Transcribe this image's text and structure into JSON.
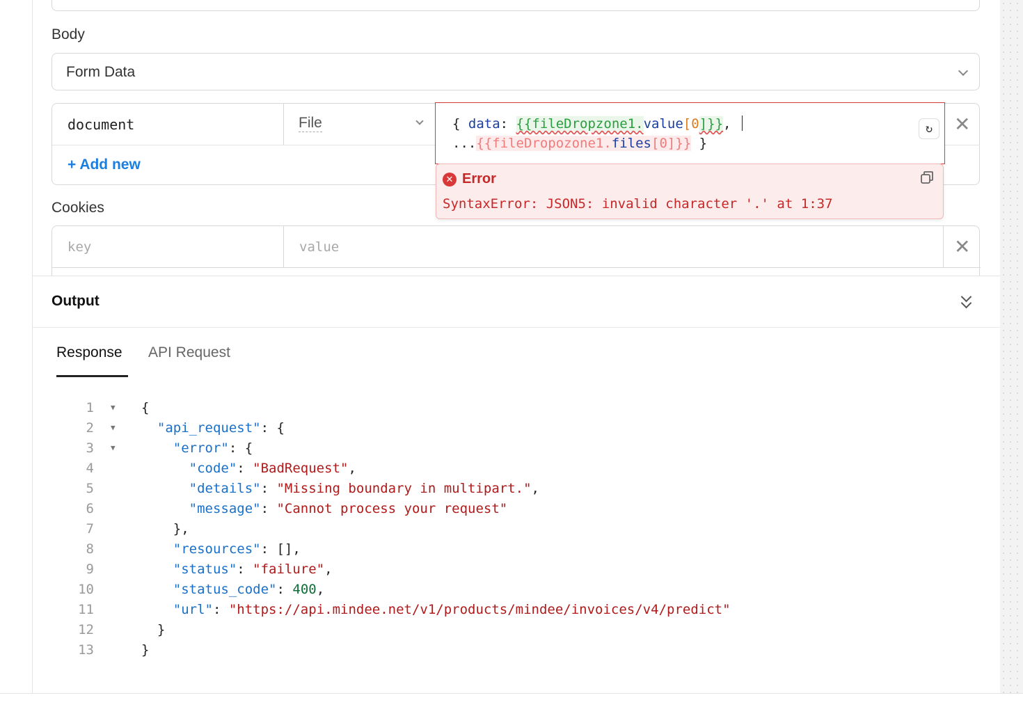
{
  "body_section": {
    "label": "Body",
    "body_type": "Form Data"
  },
  "form_row": {
    "key": "document",
    "type": "File",
    "value_line1_parts": [
      "{ ",
      "data",
      ": ",
      "{{fileDropzone1.",
      "value",
      "[",
      "0",
      "]}}",
      ","
    ],
    "value_line2_parts": [
      "...",
      "{{fileDropozone1.",
      "files",
      "[",
      "0",
      "]}}",
      " }"
    ],
    "add_new_label": "+ Add new"
  },
  "error_popup": {
    "title": "Error",
    "message": "SyntaxError: JSON5: invalid character '.' at 1:37"
  },
  "cookies_section": {
    "label": "Cookies",
    "key_placeholder": "key",
    "value_placeholder": "value"
  },
  "output": {
    "title": "Output",
    "tabs": [
      {
        "label": "Response",
        "active": true
      },
      {
        "label": "API Request",
        "active": false
      }
    ]
  },
  "response_code": {
    "line_numbers": [
      "1",
      "2",
      "3",
      "4",
      "5",
      "6",
      "7",
      "8",
      "9",
      "10",
      "11",
      "12",
      "13"
    ],
    "lines": [
      {
        "indent": "",
        "parts": [
          {
            "t": "{",
            "c": "p"
          }
        ]
      },
      {
        "indent": "  ",
        "parts": [
          {
            "t": "\"api_request\"",
            "c": "k"
          },
          {
            "t": ": {",
            "c": "p"
          }
        ]
      },
      {
        "indent": "    ",
        "parts": [
          {
            "t": "\"error\"",
            "c": "k"
          },
          {
            "t": ": {",
            "c": "p"
          }
        ]
      },
      {
        "indent": "      ",
        "parts": [
          {
            "t": "\"code\"",
            "c": "k"
          },
          {
            "t": ": ",
            "c": "p"
          },
          {
            "t": "\"BadRequest\"",
            "c": "s"
          },
          {
            "t": ",",
            "c": "p"
          }
        ]
      },
      {
        "indent": "      ",
        "parts": [
          {
            "t": "\"details\"",
            "c": "k"
          },
          {
            "t": ": ",
            "c": "p"
          },
          {
            "t": "\"Missing boundary in multipart.\"",
            "c": "s"
          },
          {
            "t": ",",
            "c": "p"
          }
        ]
      },
      {
        "indent": "      ",
        "parts": [
          {
            "t": "\"message\"",
            "c": "k"
          },
          {
            "t": ": ",
            "c": "p"
          },
          {
            "t": "\"Cannot process your request\"",
            "c": "s"
          }
        ]
      },
      {
        "indent": "    ",
        "parts": [
          {
            "t": "},",
            "c": "p"
          }
        ]
      },
      {
        "indent": "    ",
        "parts": [
          {
            "t": "\"resources\"",
            "c": "k"
          },
          {
            "t": ": [],",
            "c": "p"
          }
        ]
      },
      {
        "indent": "    ",
        "parts": [
          {
            "t": "\"status\"",
            "c": "k"
          },
          {
            "t": ": ",
            "c": "p"
          },
          {
            "t": "\"failure\"",
            "c": "s"
          },
          {
            "t": ",",
            "c": "p"
          }
        ]
      },
      {
        "indent": "    ",
        "parts": [
          {
            "t": "\"status_code\"",
            "c": "k"
          },
          {
            "t": ": ",
            "c": "p"
          },
          {
            "t": "400",
            "c": "n"
          },
          {
            "t": ",",
            "c": "p"
          }
        ]
      },
      {
        "indent": "    ",
        "parts": [
          {
            "t": "\"url\"",
            "c": "k"
          },
          {
            "t": ": ",
            "c": "p"
          },
          {
            "t": "\"https://api.mindee.net/v1/products/mindee/invoices/v4/predict\"",
            "c": "s"
          }
        ]
      },
      {
        "indent": "  ",
        "parts": [
          {
            "t": "}",
            "c": "p"
          }
        ]
      },
      {
        "indent": "",
        "parts": [
          {
            "t": "}",
            "c": "p"
          }
        ]
      }
    ],
    "foldable_lines": [
      1,
      2,
      3
    ]
  },
  "icons": {
    "type_dropdown": "chevron-down-icon",
    "body_dropdown": "chevron-down-icon",
    "reformat": "reformat-icon",
    "remove": "close-icon",
    "error": "error-circle-icon",
    "copy": "copy-icon",
    "collapse": "double-chevron-down-icon",
    "fold": "fold-triangle-icon"
  },
  "colors": {
    "accent": "#1a7fe0",
    "error": "#d93838",
    "error_bg": "#fdecec",
    "json_key": "#1a6fc8",
    "json_string": "#b11a1a",
    "json_number": "#0f6e36"
  }
}
